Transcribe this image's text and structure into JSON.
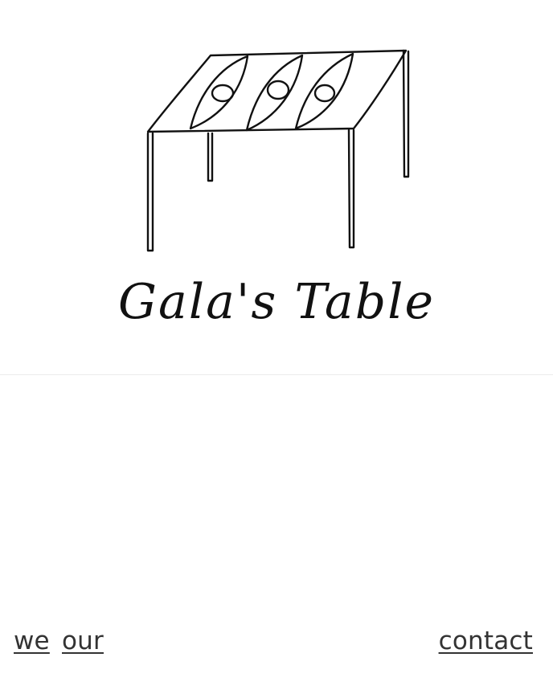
{
  "header": {
    "logo": {
      "icon": "table-with-eyes-drawing",
      "wordmark": "Gala's Table"
    }
  },
  "nav": {
    "left": [
      {
        "label": "we"
      },
      {
        "label": "our"
      }
    ],
    "right": [
      {
        "label": "contact"
      }
    ]
  },
  "colors": {
    "background": "#ffffff",
    "ink": "#111111",
    "link": "#333333",
    "divider": "#ececec"
  }
}
